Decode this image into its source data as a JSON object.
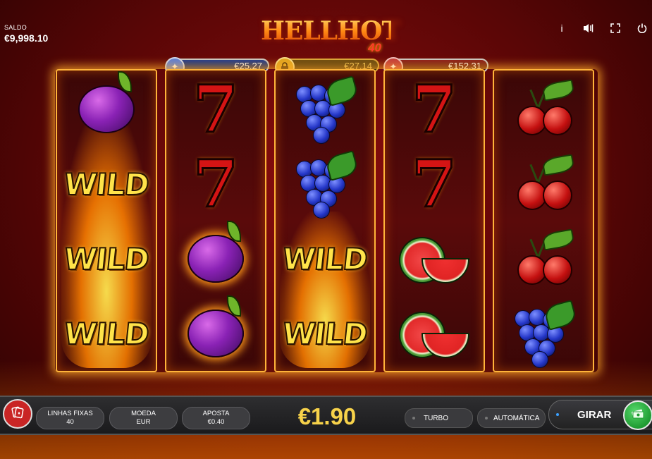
{
  "balance": {
    "label": "SALDO",
    "value": "€9,998.10"
  },
  "logo": {
    "line1": "HELLHOT",
    "line2": "40"
  },
  "top_icons": [
    "info-icon",
    "sound-icon",
    "fullscreen-icon",
    "power-icon"
  ],
  "jackpots": [
    {
      "amount": "€25,27",
      "color": "blue"
    },
    {
      "amount": "€27,14",
      "color": "gold",
      "locked": true
    },
    {
      "amount": "€152,31",
      "color": "red"
    }
  ],
  "reels": [
    [
      "plum",
      "wild",
      "wild",
      "wild"
    ],
    [
      "seven",
      "seven",
      "plum",
      "plum"
    ],
    [
      "grapes",
      "grapes",
      "wild",
      "wild"
    ],
    [
      "seven",
      "seven",
      "watermelon",
      "watermelon"
    ],
    [
      "cherries",
      "cherries",
      "cherries",
      "grapes"
    ]
  ],
  "symbols": {
    "wild_label": "WILD",
    "seven_label": "7"
  },
  "controls": {
    "lines": {
      "label": "LINHAS FIXAS",
      "value": "40"
    },
    "coin": {
      "label": "MOEDA",
      "value": "EUR"
    },
    "bet": {
      "label": "APOSTA",
      "value": "€0.40"
    },
    "total_bet": "€1.90",
    "turbo_label": "TURBO",
    "auto_label": "AUTOMÁTICA",
    "spin_label": "GIRAR"
  },
  "colors": {
    "accent_gold": "#f7d24a",
    "spin_green": "#1f9b32",
    "reel_border": "#ffb43a"
  }
}
